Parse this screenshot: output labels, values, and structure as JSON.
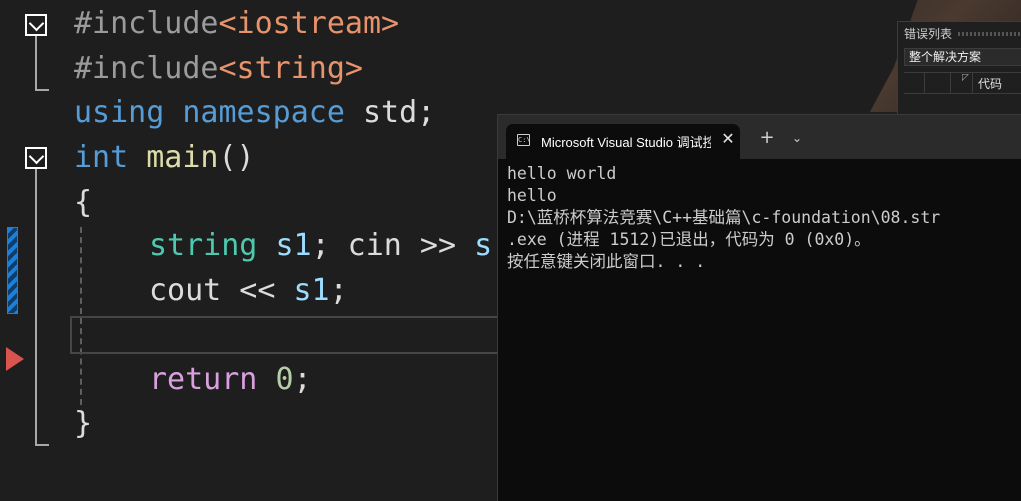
{
  "editor": {
    "lines": [
      [
        {
          "t": "#include",
          "c": "c-pre"
        },
        {
          "t": "<iostream>",
          "c": "c-inc"
        }
      ],
      [
        {
          "t": "#include",
          "c": "c-pre"
        },
        {
          "t": "<string>",
          "c": "c-inc"
        }
      ],
      [
        {
          "t": "using",
          "c": "c-kw"
        },
        {
          "t": " ",
          "c": "c-txt"
        },
        {
          "t": "namespace",
          "c": "c-kw"
        },
        {
          "t": " std;",
          "c": "c-txt"
        }
      ],
      [
        {
          "t": "int",
          "c": "c-kw"
        },
        {
          "t": " ",
          "c": "c-txt"
        },
        {
          "t": "main",
          "c": "c-fn"
        },
        {
          "t": "()",
          "c": "c-txt"
        }
      ],
      [
        {
          "t": "{",
          "c": "c-txt"
        }
      ],
      [
        {
          "t": "string",
          "c": "c-type"
        },
        {
          "t": " ",
          "c": "c-txt"
        },
        {
          "t": "s1",
          "c": "c-var"
        },
        {
          "t": "; cin >> ",
          "c": "c-txt"
        },
        {
          "t": "s",
          "c": "c-var"
        }
      ],
      [
        {
          "t": "cout << ",
          "c": "c-txt"
        },
        {
          "t": "s1",
          "c": "c-var"
        },
        {
          "t": ";",
          "c": "c-txt"
        }
      ],
      [],
      [
        {
          "t": "return",
          "c": "c-ret"
        },
        {
          "t": " ",
          "c": "c-txt"
        },
        {
          "t": "0",
          "c": "c-num"
        },
        {
          "t": ";",
          "c": "c-txt"
        }
      ],
      [
        {
          "t": "}",
          "c": "c-txt"
        }
      ]
    ]
  },
  "error_list": {
    "title": "错误列表",
    "scope": "整个解决方案",
    "code_header": "代码"
  },
  "terminal": {
    "tab_icon": "C:\\",
    "tab_title": "Microsoft Visual Studio 调试控制台",
    "close_glyph": "✕",
    "new_tab_glyph": "+",
    "dropdown_glyph": "⌄",
    "output": [
      "hello world",
      "hello",
      "D:\\蓝桥杯算法竞赛\\C++基础篇\\c-foundation\\08.str",
      ".exe (进程 1512)已退出，代码为 0 (0x0)。",
      "按任意键关闭此窗口. . ."
    ]
  }
}
